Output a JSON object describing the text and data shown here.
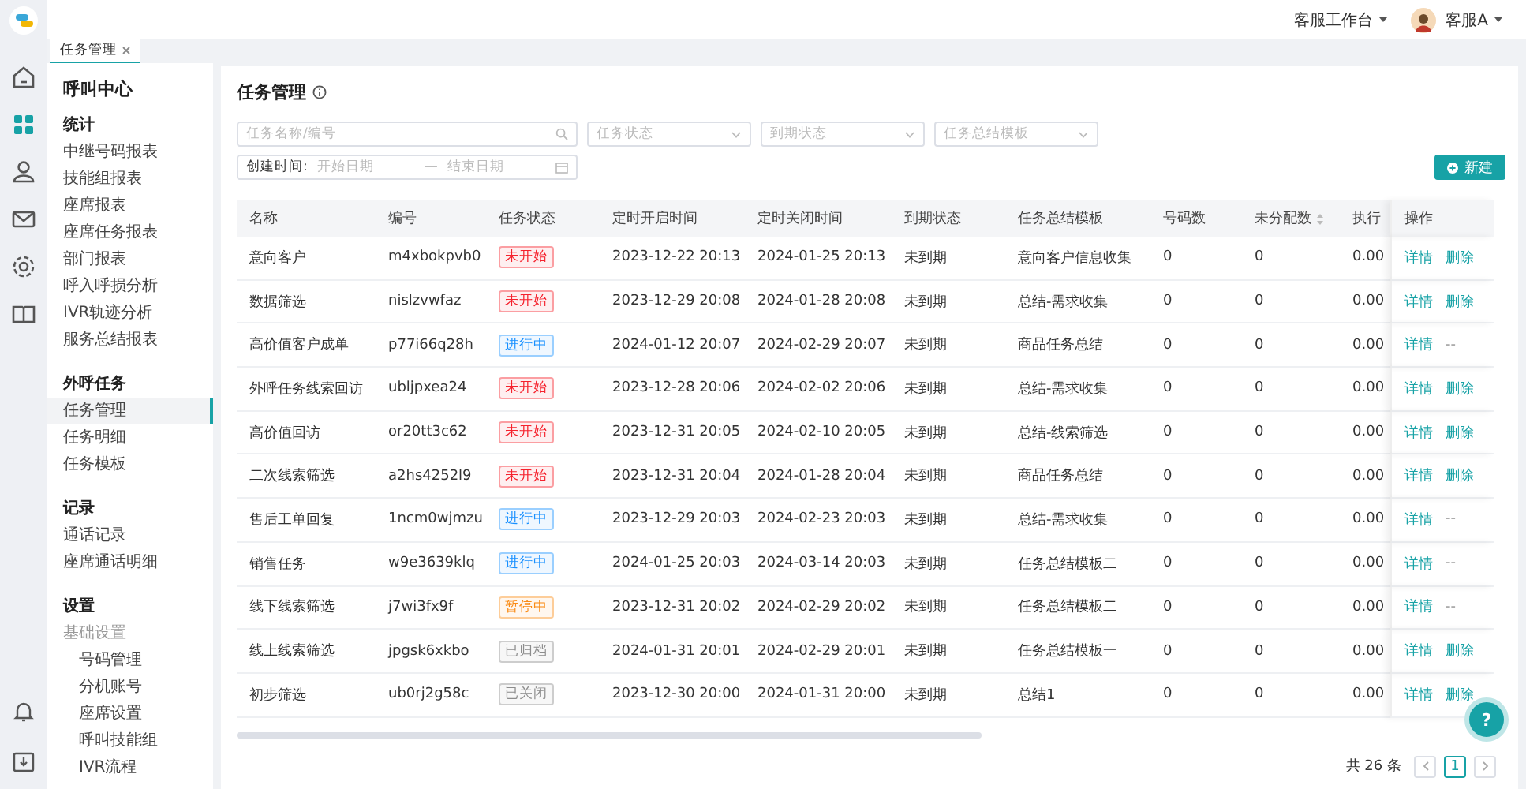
{
  "rail": [
    {
      "kind": "home",
      "selected": false
    },
    {
      "kind": "grid",
      "selected": true
    },
    {
      "kind": "person",
      "selected": false
    },
    {
      "kind": "mail",
      "selected": false
    },
    {
      "kind": "gear",
      "selected": false
    },
    {
      "kind": "book",
      "selected": false
    },
    {
      "kind": "bell",
      "selected": false
    },
    {
      "kind": "inbox",
      "selected": false
    }
  ],
  "topbar": {
    "workspace": "客服工作台",
    "user": "客服A"
  },
  "tabs": [
    {
      "label": "任务管理",
      "selected": true,
      "closable": true
    }
  ],
  "sidebar": {
    "title": "呼叫中心",
    "sections": [
      {
        "title": "统计",
        "items": [
          {
            "label": "中继号码报表",
            "selected": false
          },
          {
            "label": "技能组报表",
            "selected": false
          },
          {
            "label": "座席报表",
            "selected": false
          },
          {
            "label": "座席任务报表",
            "selected": false
          },
          {
            "label": "部门报表",
            "selected": false
          },
          {
            "label": "呼入呼损分析",
            "selected": false
          },
          {
            "label": "IVR轨迹分析",
            "selected": false
          },
          {
            "label": "服务总结报表",
            "selected": false
          }
        ]
      },
      {
        "title": "外呼任务",
        "items": [
          {
            "label": "任务管理",
            "selected": true
          },
          {
            "label": "任务明细",
            "selected": false
          },
          {
            "label": "任务模板",
            "selected": false
          }
        ]
      },
      {
        "title": "记录",
        "items": [
          {
            "label": "通话记录",
            "selected": false
          },
          {
            "label": "座席通话明细",
            "selected": false
          }
        ]
      },
      {
        "title": "设置",
        "items": [
          {
            "label": "基础设置",
            "selected": false,
            "children": [
              {
                "label": "号码管理",
                "selected": false
              },
              {
                "label": "分机账号",
                "selected": false
              },
              {
                "label": "座席设置",
                "selected": false
              },
              {
                "label": "呼叫技能组",
                "selected": false
              },
              {
                "label": "IVR流程",
                "selected": false
              }
            ]
          }
        ]
      }
    ]
  },
  "page": {
    "title": "任务管理"
  },
  "filters": {
    "search": {
      "placeholder": "任务名称/编号"
    },
    "selects": [
      {
        "placeholder": "任务状态"
      },
      {
        "placeholder": "到期状态"
      },
      {
        "placeholder": "任务总结模板"
      }
    ],
    "date_range": {
      "label": "创建时间:",
      "start_placeholder": "开始日期",
      "separator": "—",
      "end_placeholder": "结束日期"
    }
  },
  "new_button": {
    "label": "新建"
  },
  "table": {
    "columns": [
      {
        "label": "名称",
        "sortable": false
      },
      {
        "label": "编号",
        "sortable": false
      },
      {
        "label": "任务状态",
        "sortable": false
      },
      {
        "label": "定时开启时间",
        "sortable": false
      },
      {
        "label": "定时关闭时间",
        "sortable": false
      },
      {
        "label": "到期状态",
        "sortable": false
      },
      {
        "label": "任务总结模板",
        "sortable": false
      },
      {
        "label": "号码数",
        "sortable": false
      },
      {
        "label": "未分配数",
        "sortable": true
      },
      {
        "label": "执行",
        "sortable": false
      },
      {
        "label": "操作",
        "sortable": false
      }
    ],
    "rows": [
      {
        "name": "意向客户",
        "code": "m4xbokpvb0",
        "status": {
          "label": "未开始",
          "color": "#f5222d"
        },
        "start": "2023-12-22 20:13",
        "end": "2024-01-25 20:13",
        "expiry": "未到期",
        "template": "意向客户信息收集",
        "numbers": "0",
        "unassigned": "0",
        "rate": "0.00",
        "actions": [
          {
            "label": "详情",
            "kind": "link"
          },
          {
            "label": "删除",
            "kind": "link"
          }
        ]
      },
      {
        "name": "数据筛选",
        "code": "nislzvwfaz",
        "status": {
          "label": "未开始",
          "color": "#f5222d"
        },
        "start": "2023-12-29 20:08",
        "end": "2024-01-28 20:08",
        "expiry": "未到期",
        "template": "总结-需求收集",
        "numbers": "0",
        "unassigned": "0",
        "rate": "0.00",
        "actions": [
          {
            "label": "详情",
            "kind": "link"
          },
          {
            "label": "删除",
            "kind": "link"
          }
        ]
      },
      {
        "name": "高价值客户成单",
        "code": "p77i66q28h",
        "status": {
          "label": "进行中",
          "color": "#1890ff"
        },
        "start": "2024-01-12 20:07",
        "end": "2024-02-29 20:07",
        "expiry": "未到期",
        "template": "商品任务总结",
        "numbers": "0",
        "unassigned": "0",
        "rate": "0.00",
        "actions": [
          {
            "label": "详情",
            "kind": "link"
          },
          {
            "label": "--",
            "kind": "text"
          }
        ]
      },
      {
        "name": "外呼任务线索回访",
        "code": "ubljpxea24",
        "status": {
          "label": "未开始",
          "color": "#f5222d"
        },
        "start": "2023-12-28 20:06",
        "end": "2024-02-02 20:06",
        "expiry": "未到期",
        "template": "总结-需求收集",
        "numbers": "0",
        "unassigned": "0",
        "rate": "0.00",
        "actions": [
          {
            "label": "详情",
            "kind": "link"
          },
          {
            "label": "删除",
            "kind": "link"
          }
        ]
      },
      {
        "name": "高价值回访",
        "code": "or20tt3c62",
        "status": {
          "label": "未开始",
          "color": "#f5222d"
        },
        "start": "2023-12-31 20:05",
        "end": "2024-02-10 20:05",
        "expiry": "未到期",
        "template": "总结-线索筛选",
        "numbers": "0",
        "unassigned": "0",
        "rate": "0.00",
        "actions": [
          {
            "label": "详情",
            "kind": "link"
          },
          {
            "label": "删除",
            "kind": "link"
          }
        ]
      },
      {
        "name": "二次线索筛选",
        "code": "a2hs4252l9",
        "status": {
          "label": "未开始",
          "color": "#f5222d"
        },
        "start": "2023-12-31 20:04",
        "end": "2024-01-28 20:04",
        "expiry": "未到期",
        "template": "商品任务总结",
        "numbers": "0",
        "unassigned": "0",
        "rate": "0.00",
        "actions": [
          {
            "label": "详情",
            "kind": "link"
          },
          {
            "label": "删除",
            "kind": "link"
          }
        ]
      },
      {
        "name": "售后工单回复",
        "code": "1ncm0wjmzu",
        "status": {
          "label": "进行中",
          "color": "#1890ff"
        },
        "start": "2023-12-29 20:03",
        "end": "2024-02-23 20:03",
        "expiry": "未到期",
        "template": "总结-需求收集",
        "numbers": "0",
        "unassigned": "0",
        "rate": "0.00",
        "actions": [
          {
            "label": "详情",
            "kind": "link"
          },
          {
            "label": "--",
            "kind": "text"
          }
        ]
      },
      {
        "name": "销售任务",
        "code": "w9e3639klq",
        "status": {
          "label": "进行中",
          "color": "#1890ff"
        },
        "start": "2024-01-25 20:03",
        "end": "2024-03-14 20:03",
        "expiry": "未到期",
        "template": "任务总结模板二",
        "numbers": "0",
        "unassigned": "0",
        "rate": "0.00",
        "actions": [
          {
            "label": "详情",
            "kind": "link"
          },
          {
            "label": "--",
            "kind": "text"
          }
        ]
      },
      {
        "name": "线下线索筛选",
        "code": "j7wi3fx9f",
        "status": {
          "label": "暂停中",
          "color": "#fa8c16"
        },
        "start": "2023-12-31 20:02",
        "end": "2024-02-29 20:02",
        "expiry": "未到期",
        "template": "任务总结模板二",
        "numbers": "0",
        "unassigned": "0",
        "rate": "0.00",
        "actions": [
          {
            "label": "详情",
            "kind": "link"
          },
          {
            "label": "--",
            "kind": "text"
          }
        ]
      },
      {
        "name": "线上线索筛选",
        "code": "jpgsk6xkbo",
        "status": {
          "label": "已归档",
          "color": "#8c8c8c"
        },
        "start": "2024-01-31 20:01",
        "end": "2024-02-29 20:01",
        "expiry": "未到期",
        "template": "任务总结模板一",
        "numbers": "0",
        "unassigned": "0",
        "rate": "0.00",
        "actions": [
          {
            "label": "详情",
            "kind": "link"
          },
          {
            "label": "删除",
            "kind": "link"
          }
        ]
      },
      {
        "name": "初步筛选",
        "code": "ub0rj2g58c",
        "status": {
          "label": "已关闭",
          "color": "#8c8c8c"
        },
        "start": "2023-12-30 20:00",
        "end": "2024-01-31 20:00",
        "expiry": "未到期",
        "template": "总结1",
        "numbers": "0",
        "unassigned": "0",
        "rate": "0.00",
        "actions": [
          {
            "label": "详情",
            "kind": "link"
          },
          {
            "label": "删除",
            "kind": "link"
          }
        ]
      }
    ]
  },
  "pagination": {
    "total": "共 26 条",
    "pages": [
      {
        "label": "1",
        "selected": true
      }
    ]
  },
  "help_button": {
    "label": "?"
  }
}
